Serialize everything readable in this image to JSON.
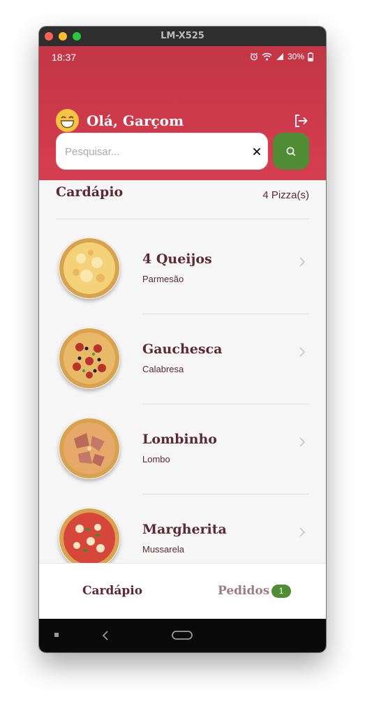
{
  "window": {
    "title": "LM-X525"
  },
  "status_bar": {
    "time": "18:37",
    "battery": "30%"
  },
  "header": {
    "greeting": "Olá, Garçom"
  },
  "search": {
    "placeholder": "Pesquisar..."
  },
  "menu": {
    "title": "Cardápio",
    "count_label": "4 Pizza(s)",
    "items": [
      {
        "name": "4 Queijos",
        "desc": "Parmesão"
      },
      {
        "name": "Gauchesca",
        "desc": "Calabresa"
      },
      {
        "name": "Lombinho",
        "desc": "Lombo"
      },
      {
        "name": "Margherita",
        "desc": "Mussarela"
      }
    ]
  },
  "bottom_nav": {
    "tabs": [
      {
        "label": "Cardápio"
      },
      {
        "label": "Pedidos"
      }
    ],
    "orders_badge": "1"
  },
  "colors": {
    "header": "#c23645",
    "accent_green": "#4f8c34",
    "text_dark": "#5a2a36"
  },
  "icons": [
    "smiling-emoji-icon",
    "logout-icon",
    "close-icon",
    "search-icon",
    "chevron-right-icon",
    "alarm-icon",
    "wifi-icon",
    "signal-icon",
    "battery-icon"
  ]
}
